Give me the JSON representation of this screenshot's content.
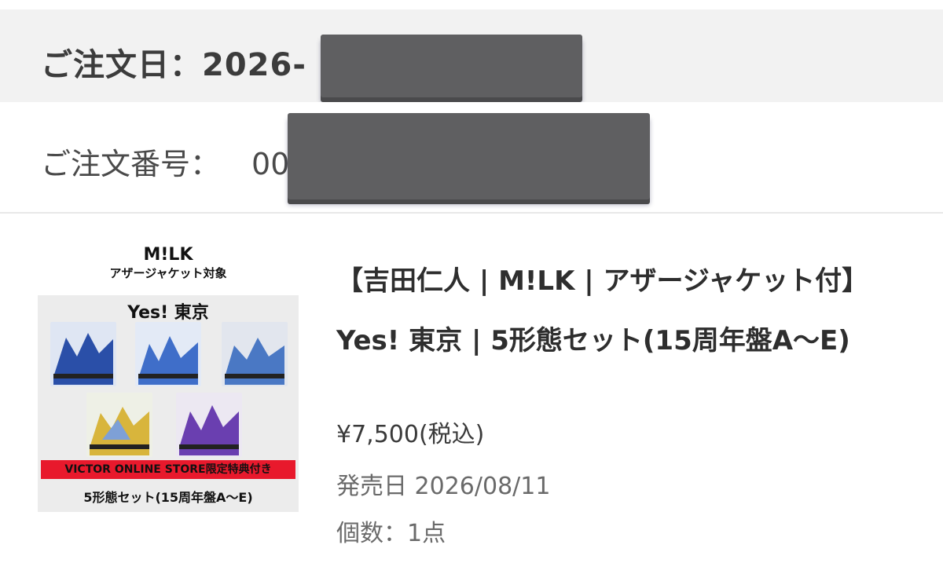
{
  "order": {
    "date_label": "ご注文日：2026-",
    "number_label": "ご注文番号：",
    "number_prefix": "00"
  },
  "product": {
    "thumbnail": {
      "brand": "M!LK",
      "subtitle": "アザージャケット対象",
      "title": "Yes! 東京",
      "banner": "VICTOR ONLINE STORE限定特典付き",
      "footer": "5形態セット(15周年盤A～E)",
      "cover_colors": [
        "#2a4fa8",
        "#3f6ec9",
        "#4a78c4",
        "#d8b53c",
        "#6a3fb0"
      ]
    },
    "title": "【吉田仁人 | M!LK | アザージャケット付】Yes! 東京 | 5形態セット(15周年盤A～E)",
    "price": "¥7,500(税込)",
    "release": "発売日 2026/08/11",
    "quantity": "個数：1点"
  },
  "colors": {
    "header_bg": "#f2f2f2",
    "redaction": "#5f5f61",
    "banner_red": "#e8192c"
  }
}
